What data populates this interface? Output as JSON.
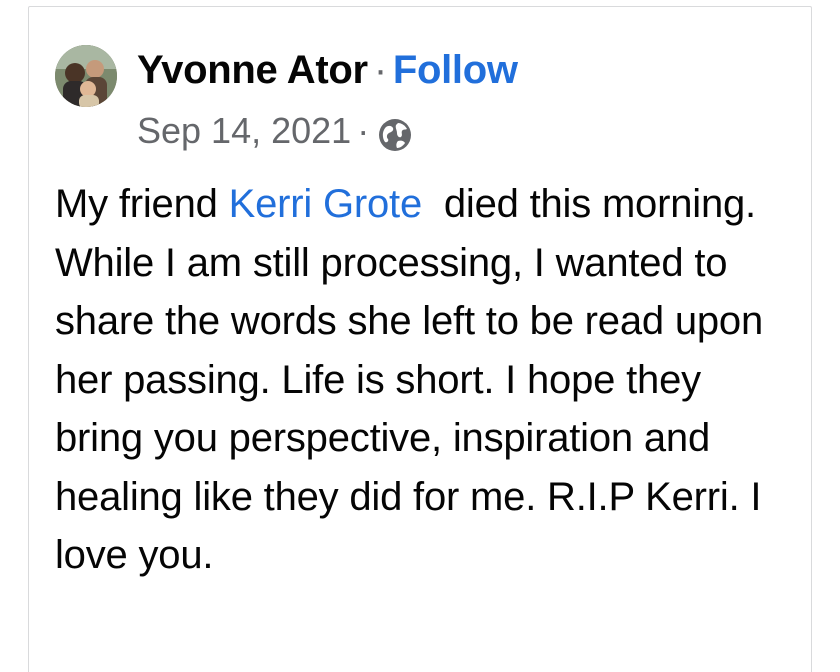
{
  "post": {
    "author": {
      "name": "Yvonne Ator",
      "separator": "·",
      "follow_label": "Follow"
    },
    "meta": {
      "date": "Sep 14, 2021",
      "separator": "·",
      "privacy_icon": "globe-icon"
    },
    "body": {
      "intro": "My friend ",
      "mention": "Kerri Grote",
      "text": "  died this morning.  While I am still processing, I wanted to share the words she left to be read upon her passing. Life is short. I hope they bring you perspective, inspiration and healing like they did for me. R.I.P Kerri. I love you."
    }
  },
  "colors": {
    "link": "#216fdb",
    "text": "#050505",
    "meta": "#65676b",
    "border": "#d9dadc"
  }
}
